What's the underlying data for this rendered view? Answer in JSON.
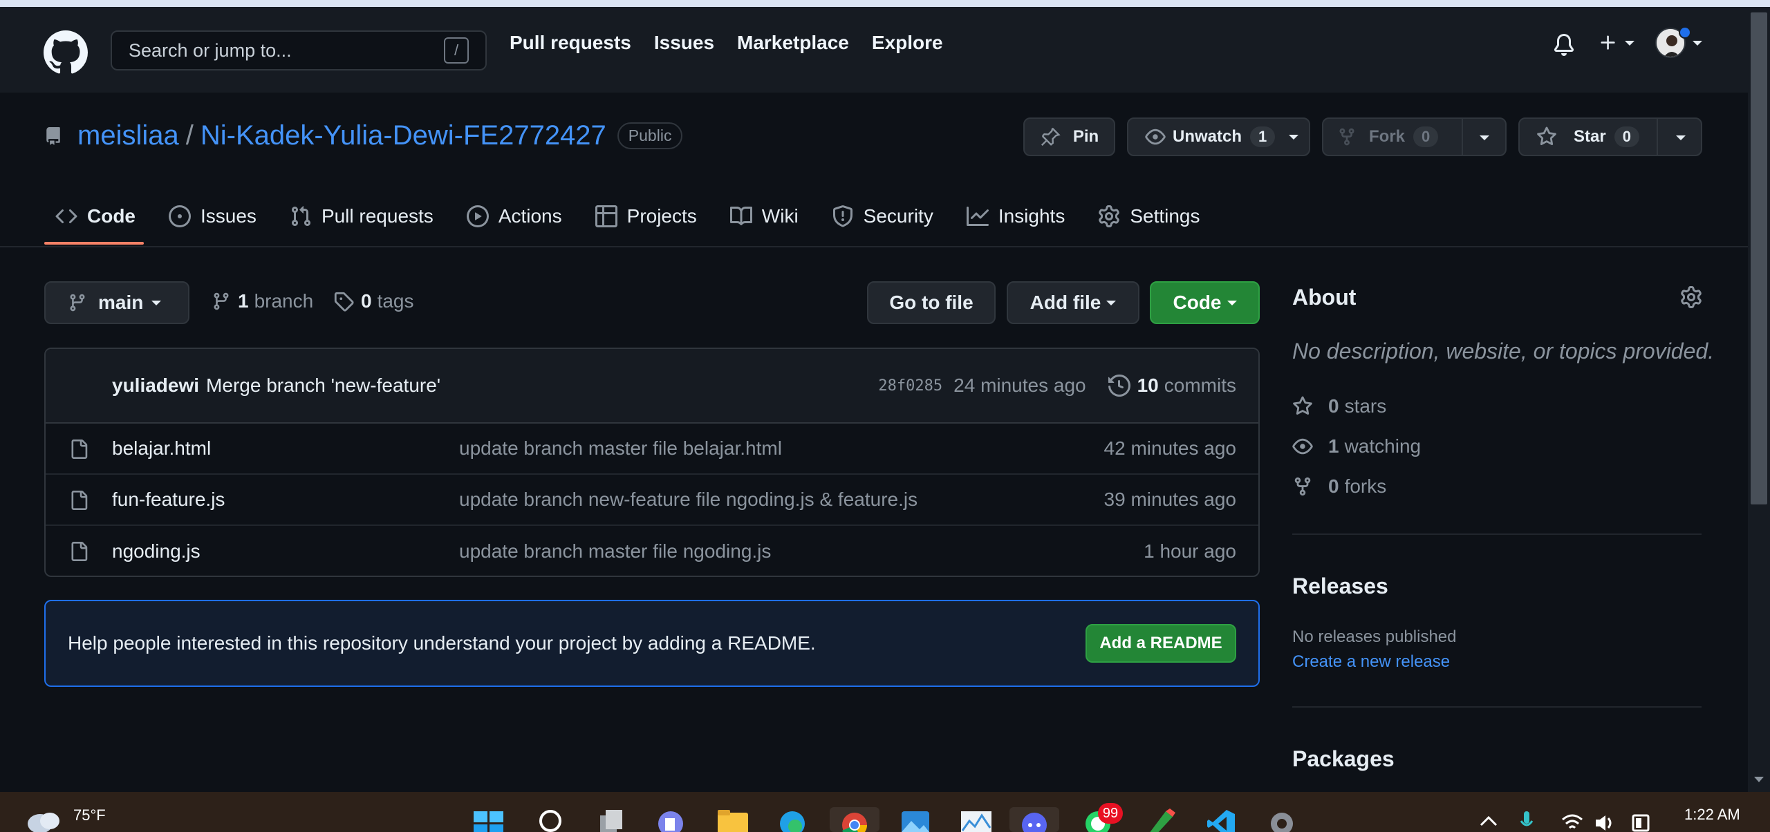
{
  "header": {
    "search_placeholder": "Search or jump to...",
    "search_shortcut": "/",
    "nav": [
      "Pull requests",
      "Issues",
      "Marketplace",
      "Explore"
    ]
  },
  "repo": {
    "owner": "meisliaa",
    "separator": "/",
    "name": "Ni-Kadek-Yulia-Dewi-FE2772427",
    "visibility": "Public",
    "pin_label": "Pin",
    "unwatch_label": "Unwatch",
    "watch_count": "1",
    "fork_label": "Fork",
    "fork_count": "0",
    "star_label": "Star",
    "star_count": "0"
  },
  "tabs": [
    {
      "label": "Code",
      "icon": "code-icon",
      "active": true
    },
    {
      "label": "Issues",
      "icon": "issue-opened-icon"
    },
    {
      "label": "Pull requests",
      "icon": "git-pull-request-icon"
    },
    {
      "label": "Actions",
      "icon": "play-icon"
    },
    {
      "label": "Projects",
      "icon": "table-icon"
    },
    {
      "label": "Wiki",
      "icon": "book-icon"
    },
    {
      "label": "Security",
      "icon": "shield-icon"
    },
    {
      "label": "Insights",
      "icon": "graph-icon"
    },
    {
      "label": "Settings",
      "icon": "gear-icon"
    }
  ],
  "file_nav": {
    "branch": "main",
    "branch_count": "1",
    "branch_word": "branch",
    "tag_count": "0",
    "tag_word": "tags",
    "go_to_file": "Go to file",
    "add_file": "Add file",
    "code": "Code"
  },
  "latest_commit": {
    "author": "yuliadewi",
    "message": "Merge branch 'new-feature'",
    "sha": "28f0285",
    "time": "24 minutes ago",
    "commit_count": "10",
    "commit_word": "commits"
  },
  "files": [
    {
      "name": "belajar.html",
      "commit": "update branch master file belajar.html",
      "time": "42 minutes ago"
    },
    {
      "name": "fun-feature.js",
      "commit": "update branch new-feature file ngoding.js & feature.js",
      "time": "39 minutes ago"
    },
    {
      "name": "ngoding.js",
      "commit": "update branch master file ngoding.js",
      "time": "1 hour ago"
    }
  ],
  "readme_banner": {
    "text": "Help people interested in this repository understand your project by adding a README.",
    "button": "Add a README"
  },
  "sidebar": {
    "about_title": "About",
    "about_desc": "No description, website, or topics provided.",
    "stars_count": "0",
    "stars_word": "stars",
    "watching_count": "1",
    "watching_word": "watching",
    "forks_count": "0",
    "forks_word": "forks",
    "releases_title": "Releases",
    "no_releases": "No releases published",
    "create_release": "Create a new release",
    "packages_title": "Packages"
  },
  "taskbar": {
    "temperature": "75°F",
    "clock": "1:22 AM",
    "notification_badge": "99",
    "icons": [
      "start-icon",
      "search-icon",
      "task-view-icon",
      "teams-icon",
      "file-explorer-icon",
      "edge-icon",
      "chrome-icon",
      "photos-icon",
      "task-manager-icon",
      "discord-icon",
      "whatsapp-icon",
      "pen-icon",
      "vscode-icon",
      "settings-icon"
    ]
  },
  "colors": {
    "accent_link": "#4493f8",
    "primary_green": "#238636",
    "tab_underline": "#f78166",
    "background": "#0d1117"
  }
}
